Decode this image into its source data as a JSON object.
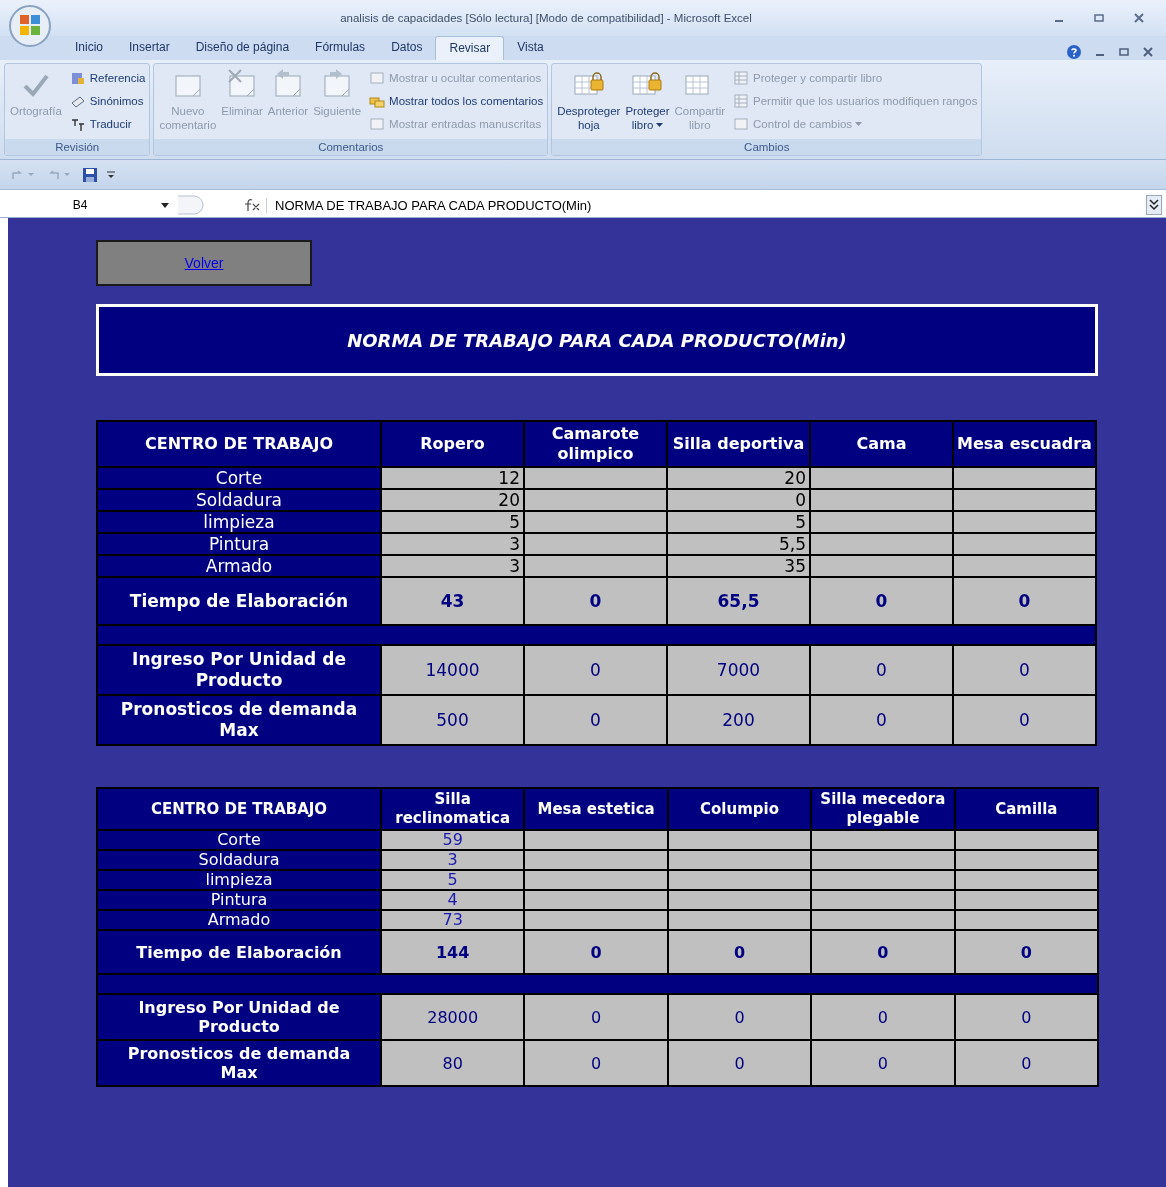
{
  "window": {
    "title": "analisis de capacidades  [Sólo lectura]  [Modo de compatibilidad] - Microsoft Excel"
  },
  "tabs": [
    {
      "label": "Inicio",
      "selected": false
    },
    {
      "label": "Insertar",
      "selected": false
    },
    {
      "label": "Diseño de página",
      "selected": false
    },
    {
      "label": "Fórmulas",
      "selected": false
    },
    {
      "label": "Datos",
      "selected": false
    },
    {
      "label": "Revisar",
      "selected": true
    },
    {
      "label": "Vista",
      "selected": false
    }
  ],
  "ribbon_groups": [
    {
      "label": "Revisión",
      "items": [
        {
          "kind": "large",
          "label": "Ortografía",
          "disabled": true,
          "dropdown": false
        },
        {
          "kind": "small",
          "label": "Referencia",
          "disabled": false,
          "dropdown": false
        },
        {
          "kind": "small",
          "label": "Sinónimos",
          "disabled": false,
          "dropdown": false
        },
        {
          "kind": "small",
          "label": "Traducir",
          "disabled": false,
          "dropdown": false
        }
      ]
    },
    {
      "label": "Comentarios",
      "items": [
        {
          "kind": "large",
          "label": "Nuevo comentario",
          "disabled": true,
          "dropdown": false
        },
        {
          "kind": "large",
          "label": "Eliminar",
          "disabled": true,
          "dropdown": false
        },
        {
          "kind": "large",
          "label": "Anterior",
          "disabled": true,
          "dropdown": false
        },
        {
          "kind": "large",
          "label": "Siguiente",
          "disabled": true,
          "dropdown": false
        },
        {
          "kind": "small",
          "label": "Mostrar u ocultar comentarios",
          "disabled": true,
          "dropdown": false
        },
        {
          "kind": "small",
          "label": "Mostrar todos los comentarios",
          "disabled": false,
          "dropdown": false
        },
        {
          "kind": "small",
          "label": "Mostrar entradas manuscritas",
          "disabled": true,
          "dropdown": false
        }
      ]
    },
    {
      "label": "Cambios",
      "items": [
        {
          "kind": "large",
          "label": "Desproteger hoja",
          "disabled": false,
          "dropdown": false
        },
        {
          "kind": "large",
          "label": "Proteger libro",
          "disabled": false,
          "dropdown": true
        },
        {
          "kind": "large",
          "label": "Compartir libro",
          "disabled": true,
          "dropdown": false
        },
        {
          "kind": "small",
          "label": "Proteger y compartir libro",
          "disabled": true,
          "dropdown": false
        },
        {
          "kind": "small",
          "label": "Permitir que los usuarios modifiquen rangos",
          "disabled": true,
          "dropdown": false
        },
        {
          "kind": "small",
          "label": "Control de cambios",
          "disabled": true,
          "dropdown": true
        }
      ]
    }
  ],
  "formula_bar": {
    "cell": "B4",
    "formula": "NORMA DE TRABAJO PARA CADA PRODUCTO(Min)"
  },
  "sheet": {
    "button": "Volver",
    "banner": "NORMA DE TRABAJO PARA CADA PRODUCTO(Min)",
    "tables": [
      {
        "columns": [
          "CENTRO DE TRABAJO",
          "Ropero",
          "Camarote olimpico",
          "Silla deportiva",
          "Cama",
          "Mesa escuadra"
        ],
        "rows": [
          {
            "kind": "detail",
            "label": "Corte",
            "cells": {
              "c1": "12",
              "c3": "20"
            }
          },
          {
            "kind": "detail",
            "label": "Soldadura",
            "cells": {
              "c1": "20",
              "c3": "0"
            }
          },
          {
            "kind": "detail",
            "label": "limpieza",
            "cells": {
              "c1": "5",
              "c3": "5"
            }
          },
          {
            "kind": "detail",
            "label": "Pintura",
            "cells": {
              "c1": "3",
              "c3": "5,5"
            }
          },
          {
            "kind": "detail",
            "label": "Armado",
            "cells": {
              "c1": "3",
              "c3": "35"
            }
          },
          {
            "kind": "total",
            "label": "Tiempo de Elaboración",
            "cells": {
              "c1": "43",
              "c2": "0",
              "c3": "65,5",
              "c4": "0",
              "c5": "0"
            }
          },
          {
            "kind": "separator"
          },
          {
            "kind": "info",
            "label": "Ingreso Por Unidad de Producto",
            "cells": {
              "c1": "14000",
              "c2": "0",
              "c3": "7000",
              "c4": "0",
              "c5": "0"
            }
          },
          {
            "kind": "info",
            "label": "Pronosticos de demanda Max",
            "cells": {
              "c1": "500",
              "c2": "0",
              "c3": "200",
              "c4": "0",
              "c5": "0"
            }
          }
        ]
      },
      {
        "columns": [
          "CENTRO DE TRABAJO",
          "Silla reclinomatica",
          "Mesa estetica",
          "Columpio",
          "Silla mecedora plegable",
          "Camilla"
        ],
        "rows": [
          {
            "kind": "detail",
            "label": "Corte",
            "cells": {
              "c1": "59"
            }
          },
          {
            "kind": "detail",
            "label": "Soldadura",
            "cells": {
              "c1": "3"
            }
          },
          {
            "kind": "detail",
            "label": "limpieza",
            "cells": {
              "c1": "5"
            }
          },
          {
            "kind": "detail",
            "label": "Pintura",
            "cells": {
              "c1": "4"
            }
          },
          {
            "kind": "detail",
            "label": "Armado",
            "cells": {
              "c1": "73"
            }
          },
          {
            "kind": "total",
            "label": "Tiempo de Elaboración",
            "cells": {
              "c1": "144",
              "c2": "0",
              "c3": "0",
              "c4": "0",
              "c5": "0"
            }
          },
          {
            "kind": "separator"
          },
          {
            "kind": "info",
            "label": "Ingreso Por Unidad de Producto",
            "cells": {
              "c1": "28000",
              "c2": "0",
              "c3": "0",
              "c4": "0",
              "c5": "0"
            }
          },
          {
            "kind": "info",
            "label": "Pronosticos de demanda Max",
            "cells": {
              "c1": "80",
              "c2": "0",
              "c3": "0",
              "c4": "0",
              "c5": "0"
            }
          }
        ]
      }
    ]
  }
}
